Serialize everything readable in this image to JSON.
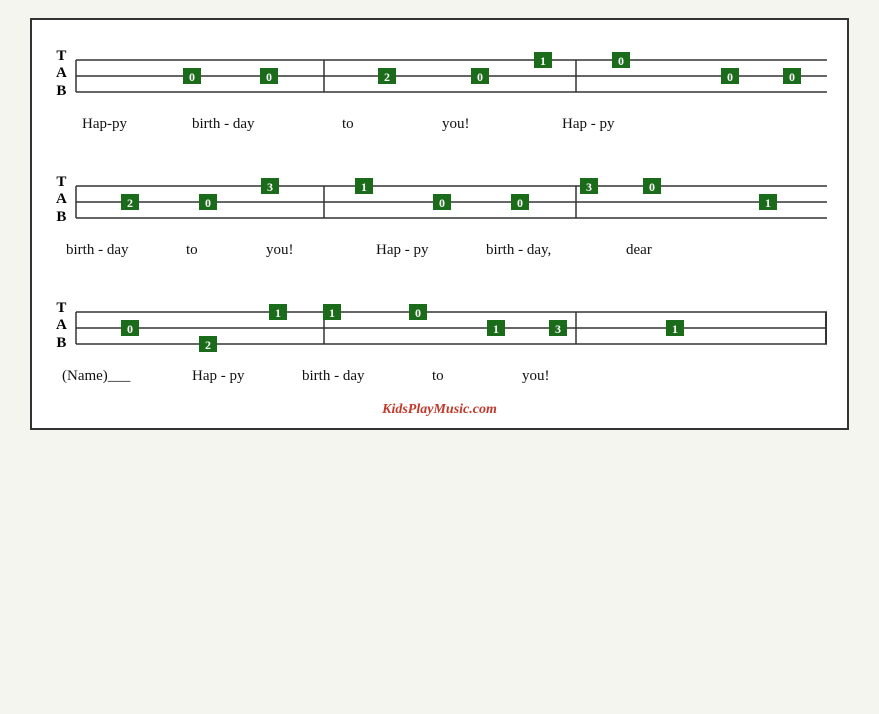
{
  "site": {
    "credit": "KidsPlayMusic.com"
  },
  "rows": [
    {
      "id": "row1",
      "measures": [
        {
          "notes": [
            {
              "string": "T",
              "fret": "0",
              "xpct": 18
            },
            {
              "string": "T",
              "fret": "0",
              "xpct": 28
            }
          ]
        },
        {
          "notes": [
            {
              "string": "T",
              "fret": "2",
              "xpct": 43
            },
            {
              "string": "T",
              "fret": "0",
              "xpct": 55
            },
            {
              "string": "top",
              "fret": "1",
              "xpct": 63
            }
          ]
        },
        {
          "notes": [
            {
              "string": "top",
              "fret": "0",
              "xpct": 73
            },
            {
              "string": "T",
              "fret": "0",
              "xpct": 87
            },
            {
              "string": "T",
              "fret": "0",
              "xpct": 95
            }
          ]
        }
      ],
      "lyrics": [
        {
          "text": "Hap-py",
          "xpct": 12
        },
        {
          "text": "birth  -  day",
          "xpct": 30
        },
        {
          "text": "to",
          "xpct": 52
        },
        {
          "text": "you!",
          "xpct": 68
        },
        {
          "text": "Hap  -  py",
          "xpct": 82
        }
      ]
    },
    {
      "id": "row2",
      "measures": [
        {
          "notes": [
            {
              "string": "T",
              "fret": "2",
              "xpct": 10
            },
            {
              "string": "T",
              "fret": "0",
              "xpct": 20
            },
            {
              "string": "top",
              "fret": "3",
              "xpct": 28
            }
          ]
        },
        {
          "notes": [
            {
              "string": "top",
              "fret": "1",
              "xpct": 40
            },
            {
              "string": "T",
              "fret": "0",
              "xpct": 50
            },
            {
              "string": "T",
              "fret": "0",
              "xpct": 60
            }
          ]
        },
        {
          "notes": [
            {
              "string": "top",
              "fret": "3",
              "xpct": 69
            },
            {
              "string": "top",
              "fret": "0",
              "xpct": 77
            },
            {
              "string": "T",
              "fret": "1",
              "xpct": 92
            }
          ]
        }
      ],
      "lyrics": [
        {
          "text": "birth  -  day",
          "xpct": 8
        },
        {
          "text": "to",
          "xpct": 27
        },
        {
          "text": "you!",
          "xpct": 38
        },
        {
          "text": "Hap  -  py",
          "xpct": 52
        },
        {
          "text": "birth  -  day,",
          "xpct": 67
        },
        {
          "text": "dear",
          "xpct": 87
        }
      ]
    },
    {
      "id": "row3",
      "measures": [
        {
          "notes": [
            {
              "string": "T",
              "fret": "0",
              "xpct": 10
            },
            {
              "string": "A",
              "fret": "2",
              "xpct": 20
            },
            {
              "string": "top",
              "fret": "1",
              "xpct": 29
            },
            {
              "string": "top",
              "fret": "1",
              "xpct": 36
            }
          ]
        },
        {
          "notes": [
            {
              "string": "top",
              "fret": "0",
              "xpct": 47
            },
            {
              "string": "T",
              "fret": "1",
              "xpct": 57
            },
            {
              "string": "T",
              "fret": "3",
              "xpct": 65
            }
          ]
        },
        {
          "notes": [
            {
              "string": "T",
              "fret": "1",
              "xpct": 80
            }
          ]
        }
      ],
      "lyrics": [
        {
          "text": "(Name)___",
          "xpct": 6
        },
        {
          "text": "Hap  -  py",
          "xpct": 23
        },
        {
          "text": "birth  -  day",
          "xpct": 42
        },
        {
          "text": "to",
          "xpct": 62
        },
        {
          "text": "you!",
          "xpct": 74
        }
      ]
    }
  ]
}
